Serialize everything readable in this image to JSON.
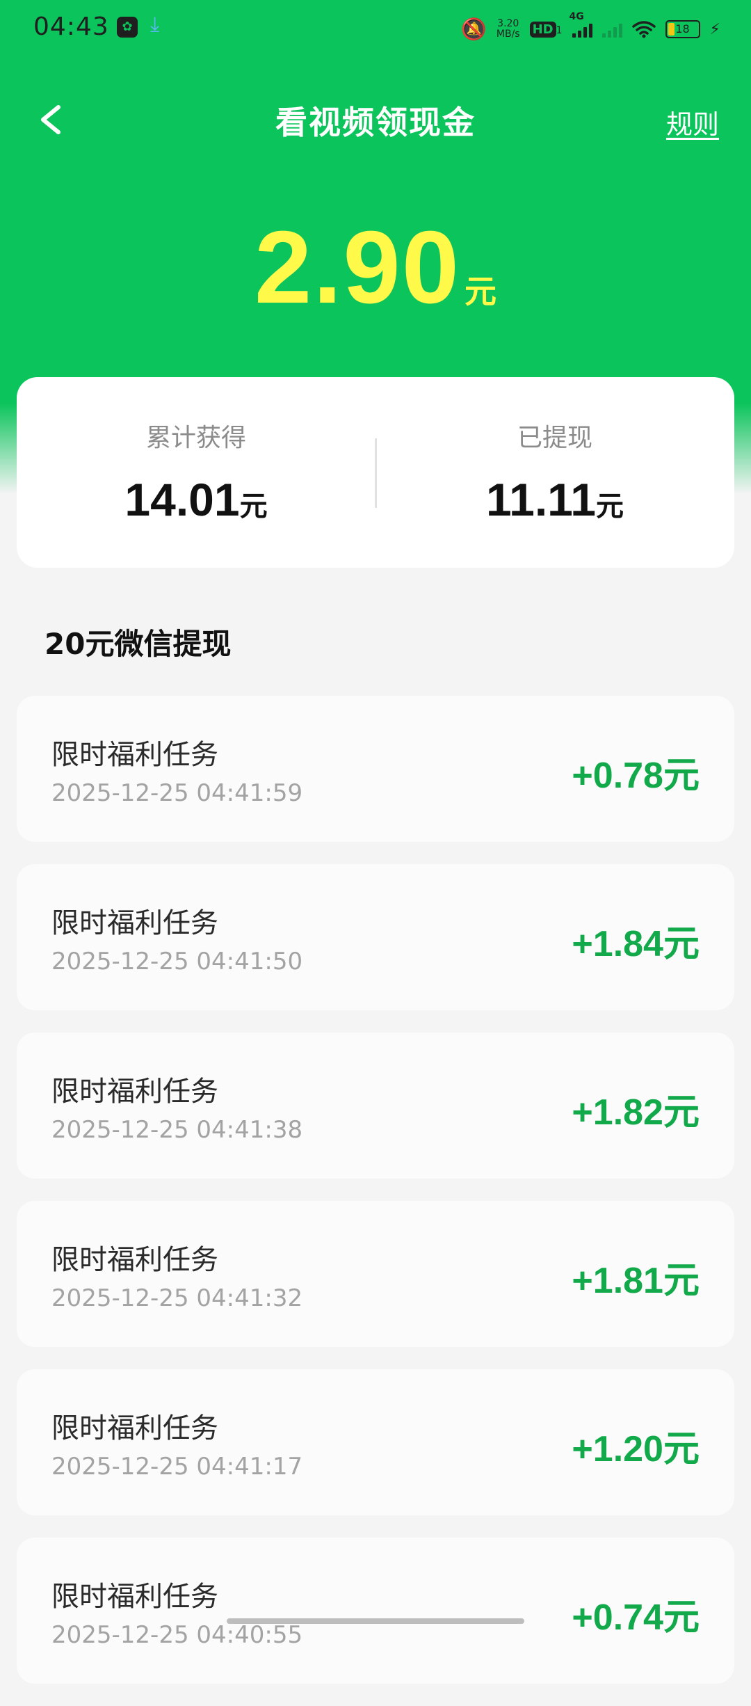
{
  "status_bar": {
    "time": "04:43",
    "net_speed_value": "3.20",
    "net_speed_unit": "MB/s",
    "hd_label": "HD",
    "hd_sub": "1",
    "network_type": "4G",
    "battery_level": "18",
    "icons": [
      "app-icon",
      "download-icon",
      "mute-icon",
      "wifi-icon",
      "battery-icon",
      "charging-bolt-icon"
    ]
  },
  "header": {
    "back_icon": "chevron-left-icon",
    "title": "看视频领现金",
    "rules_label": "规则"
  },
  "balance": {
    "amount": "2.90",
    "unit": "元"
  },
  "summary": {
    "total_earned": {
      "label": "累计获得",
      "value": "14.01",
      "unit": "元"
    },
    "withdrawn": {
      "label": "已提现",
      "value": "11.11",
      "unit": "元"
    }
  },
  "section_title": "20元微信提现",
  "records": [
    {
      "title": "限时福利任务",
      "time": "2025-12-25 04:41:59",
      "amount": "+0.78",
      "unit": "元"
    },
    {
      "title": "限时福利任务",
      "time": "2025-12-25 04:41:50",
      "amount": "+1.84",
      "unit": "元"
    },
    {
      "title": "限时福利任务",
      "time": "2025-12-25 04:41:38",
      "amount": "+1.82",
      "unit": "元"
    },
    {
      "title": "限时福利任务",
      "time": "2025-12-25 04:41:32",
      "amount": "+1.81",
      "unit": "元"
    },
    {
      "title": "限时福利任务",
      "time": "2025-12-25 04:41:17",
      "amount": "+1.20",
      "unit": "元"
    },
    {
      "title": "限时福利任务",
      "time": "2025-12-25 04:40:55",
      "amount": "+0.74",
      "unit": "元"
    }
  ],
  "colors": {
    "brand_green": "#0cc45c",
    "balance_yellow": "#fff94a",
    "amount_green": "#12a94a"
  }
}
